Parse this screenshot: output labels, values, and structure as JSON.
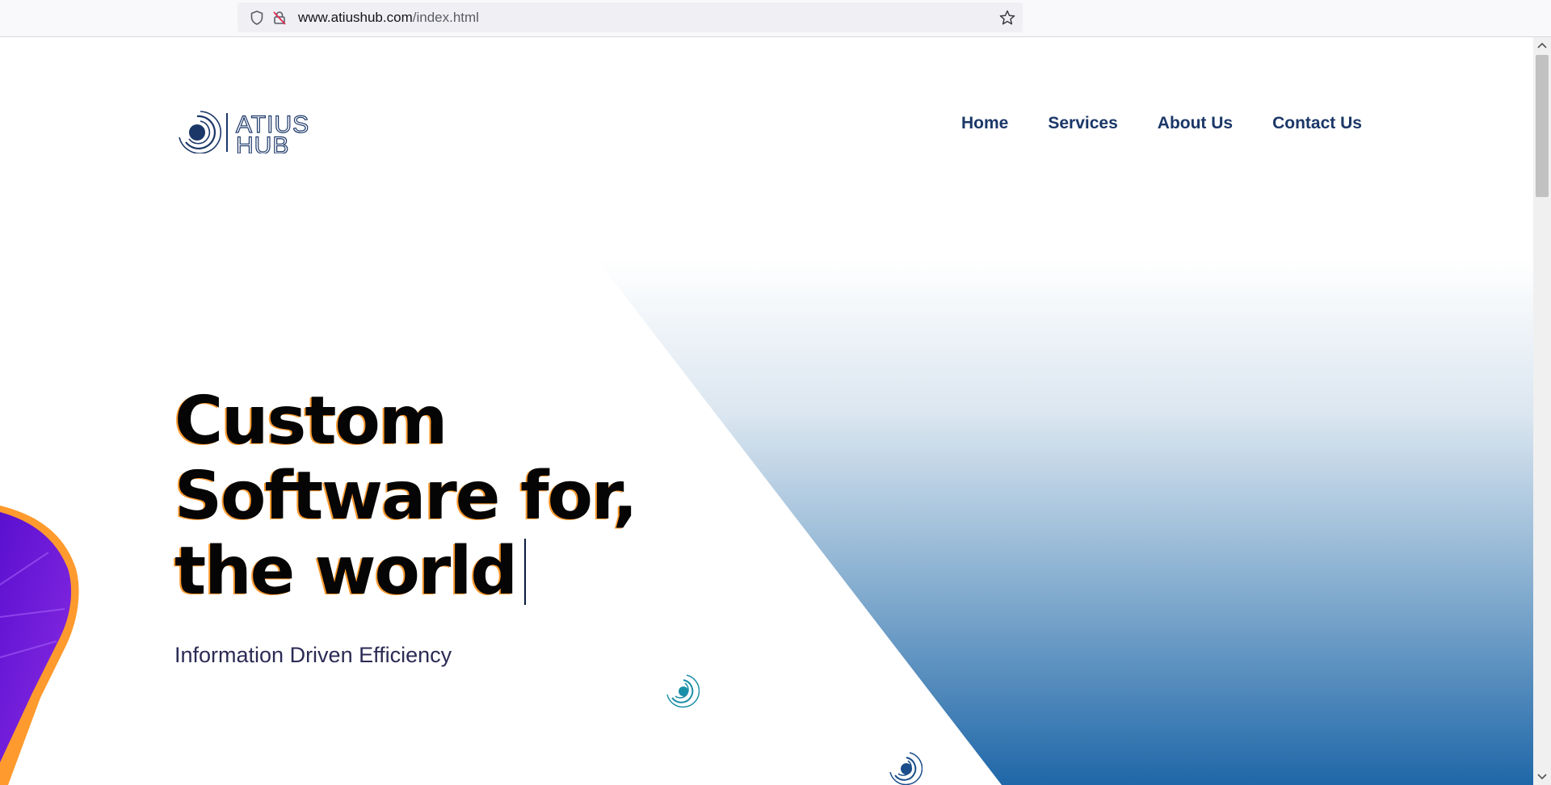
{
  "browser": {
    "url_host": "www.atiushub.com",
    "url_path": "/index.html",
    "icons": [
      "shield-icon",
      "lock-slash-icon",
      "star-icon"
    ]
  },
  "site": {
    "logo_alt": "ATIUS HUB",
    "logo_line1": "ATIUS",
    "logo_line2": "HUB",
    "nav": [
      "Home",
      "Services",
      "About Us",
      "Contact Us"
    ]
  },
  "hero": {
    "headline_lines": [
      "Custom",
      "Software for,",
      "the world"
    ],
    "subtitle": "Information Driven Efficiency"
  },
  "colors": {
    "nav_text": "#1b3768",
    "gradient_top": "#ffffff",
    "gradient_bottom": "#1f67a8",
    "accent_orange": "#ff9a2e",
    "accent_purple": "#7a1fe0",
    "orbit_teal": "#1a8fa8",
    "orbit_blue": "#1a4d8a"
  }
}
